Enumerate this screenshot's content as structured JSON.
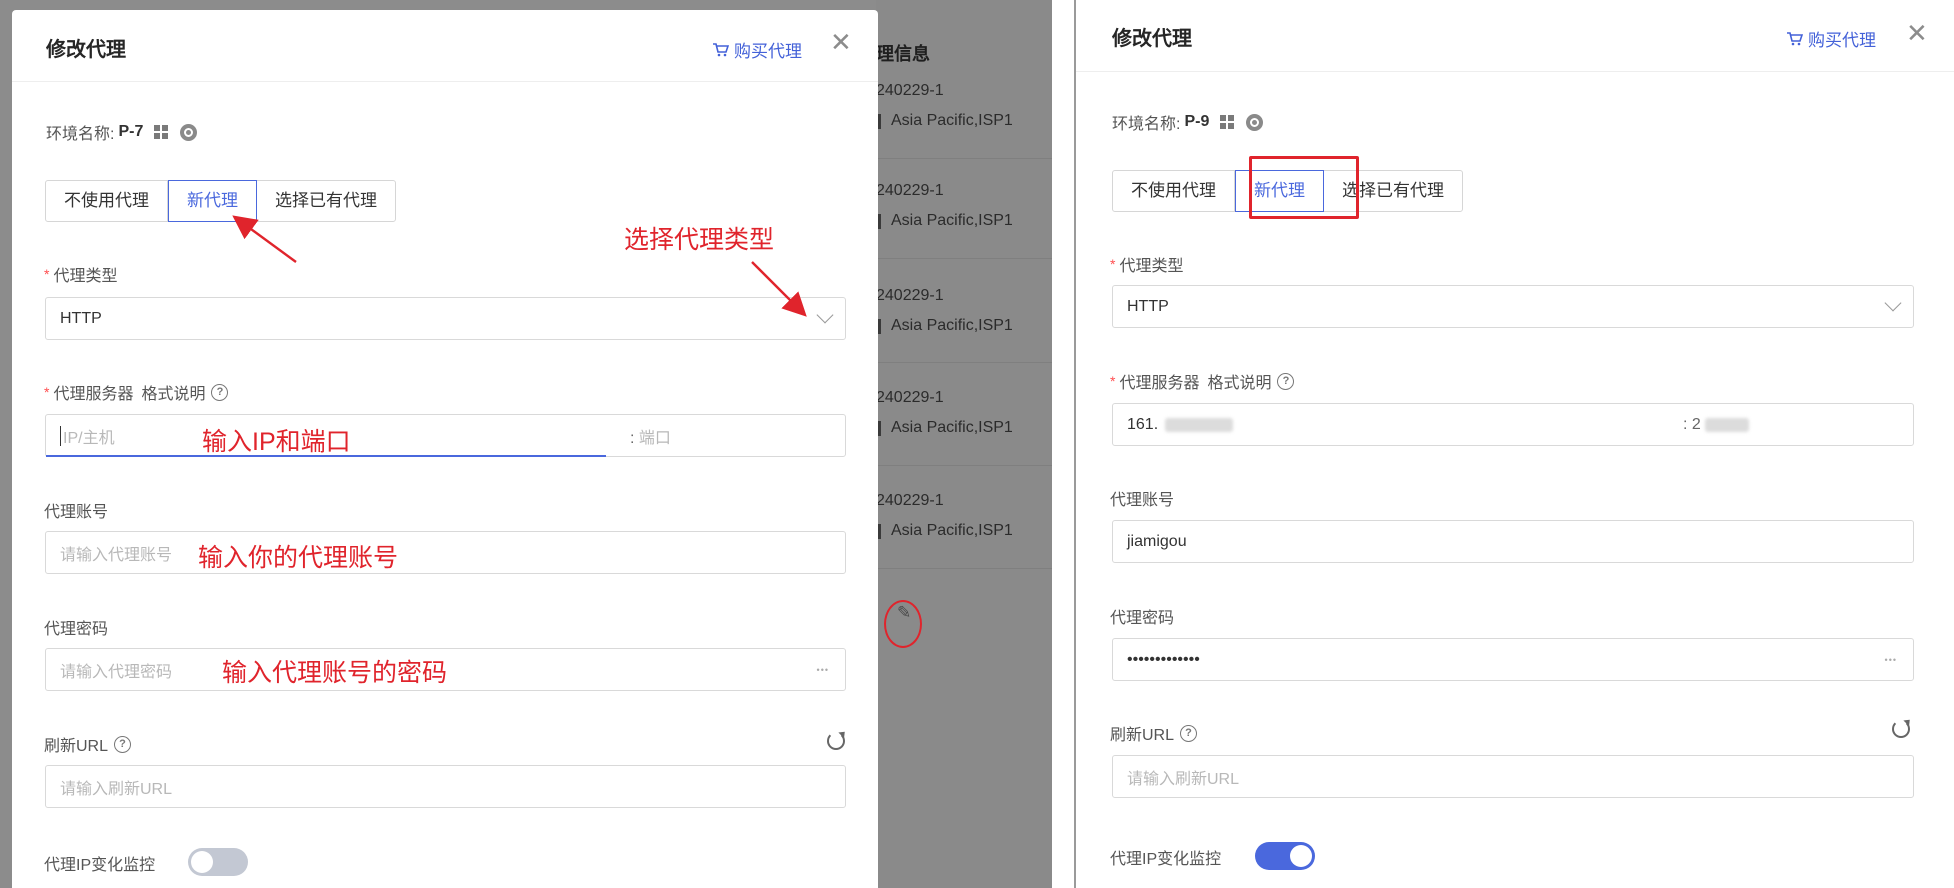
{
  "background": {
    "header": "理信息",
    "rows": [
      {
        "id": "240229-1",
        "region": "Asia Pacific,ISP1"
      },
      {
        "id": "240229-1",
        "region": "Asia Pacific,ISP1"
      },
      {
        "id": "240229-1",
        "region": "Asia Pacific,ISP1"
      },
      {
        "id": "240229-1",
        "region": "Asia Pacific,ISP1"
      },
      {
        "id": "240229-1",
        "region": "Asia Pacific,ISP1"
      }
    ],
    "edit_icon": "✎"
  },
  "left_modal": {
    "title": "修改代理",
    "buy_label": "购买代理",
    "close_glyph": "✕",
    "env_label": "环境名称:",
    "env_name": "P-7",
    "tabs": [
      "不使用代理",
      "新代理",
      "选择已有代理"
    ],
    "proxy_type_label": "代理类型",
    "proxy_type_value": "HTTP",
    "server_label": "代理服务器",
    "server_format_label": "格式说明",
    "server_host_placeholder": "IP/主机",
    "server_port_sep": ":",
    "server_port_placeholder": "端口",
    "account_label": "代理账号",
    "account_placeholder": "请输入代理账号",
    "password_label": "代理密码",
    "password_placeholder": "请输入代理密码",
    "refresh_url_label": "刷新URL",
    "refresh_url_placeholder": "请输入刷新URL",
    "ip_monitor_label": "代理IP变化监控",
    "ip_monitor_on": false,
    "question_glyph": "?",
    "pwd_icon": "•••"
  },
  "right_modal": {
    "title": "修改代理",
    "buy_label": "购买代理",
    "close_glyph": "✕",
    "env_label": "环境名称:",
    "env_name": "P-9",
    "tabs": [
      "不使用代理",
      "新代理",
      "选择已有代理"
    ],
    "proxy_type_label": "代理类型",
    "proxy_type_value": "HTTP",
    "server_label": "代理服务器",
    "server_format_label": "格式说明",
    "server_host_value": "161.",
    "server_port_sep": ": 2",
    "account_label": "代理账号",
    "account_value": "jiamigou",
    "password_label": "代理密码",
    "password_value": "•••••••••••••",
    "refresh_url_label": "刷新URL",
    "refresh_url_placeholder": "请输入刷新URL",
    "ip_monitor_label": "代理IP变化监控",
    "ip_monitor_on": true,
    "question_glyph": "?",
    "pwd_icon": "•••"
  },
  "annotations": {
    "select_type": "选择代理类型",
    "enter_ip_port": "输入IP和端口",
    "enter_account": "输入你的代理账号",
    "enter_password": "输入代理账号的密码"
  },
  "colors": {
    "accent": "#4a68dd",
    "annotation_red": "#e0242c",
    "overlay_gray": "#8c8c8c"
  }
}
